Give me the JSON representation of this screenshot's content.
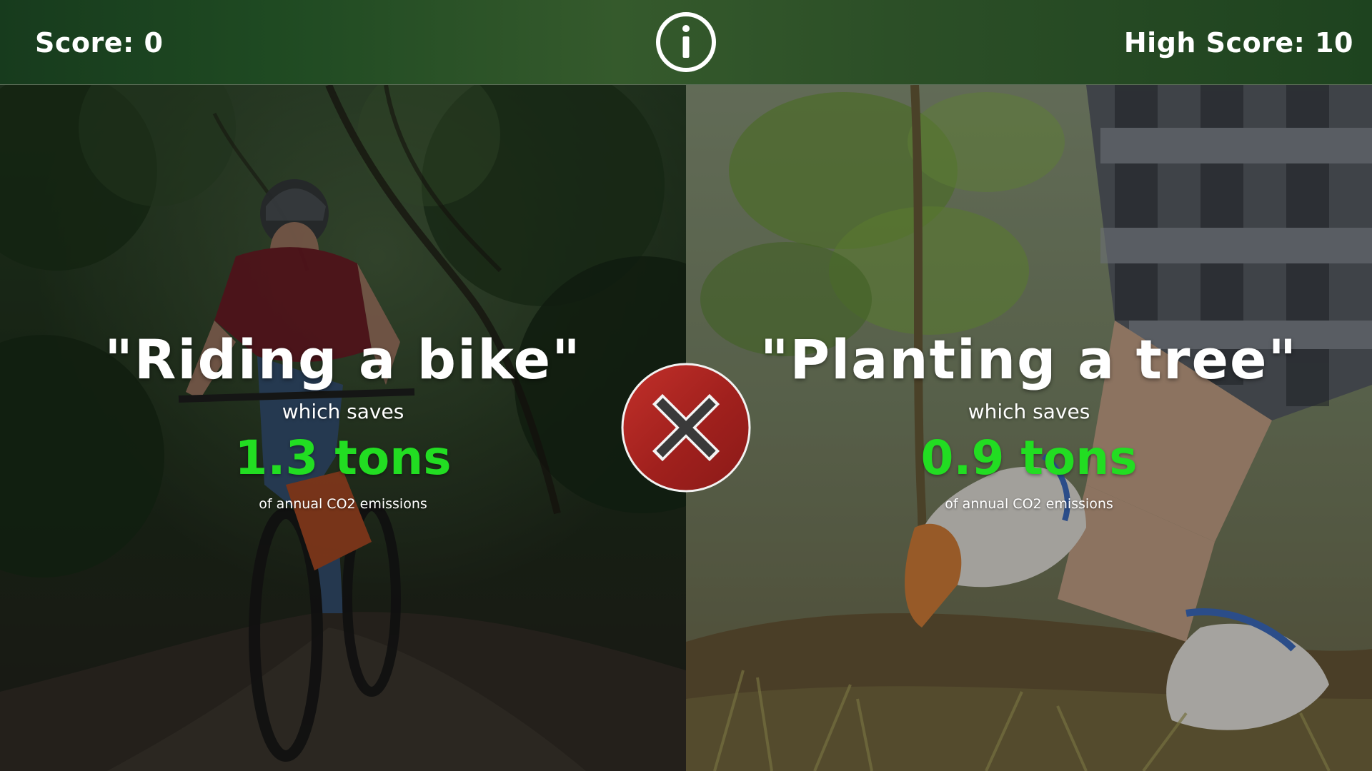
{
  "header": {
    "score_label": "Score: 0",
    "high_score_label": "High Score: 10",
    "info_icon": "info-icon"
  },
  "options": [
    {
      "title": "\"Riding a bike\"",
      "saves_text": "which saves",
      "amount": "1.3 tons",
      "suffix": "of annual CO2 emissions",
      "background": "cyclist on forest trail"
    },
    {
      "title": "\"Planting a tree\"",
      "saves_text": "which saves",
      "amount": "0.9 tons",
      "suffix": "of annual CO2 emissions",
      "background": "gloved hands planting a sapling"
    }
  ],
  "result": {
    "icon": "close-icon",
    "state": "wrong"
  },
  "colors": {
    "header_bg": "#1f4a22",
    "amount_green": "#22dd22",
    "result_red": "#b3231f"
  }
}
